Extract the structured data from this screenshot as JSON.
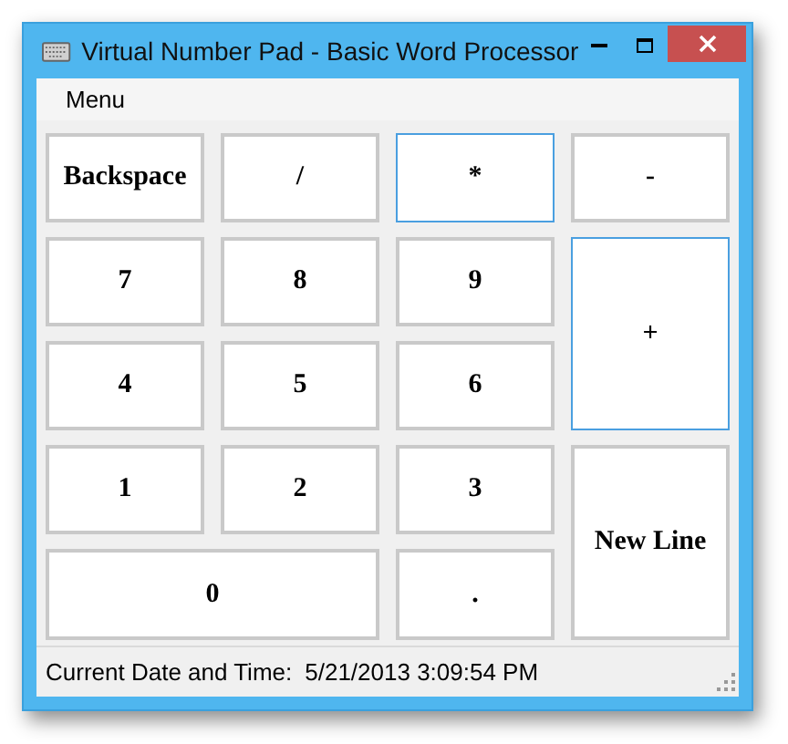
{
  "window": {
    "title": "Virtual Number Pad - Basic Word Processor"
  },
  "menu_bar": [
    "Menu"
  ],
  "keys": [
    {
      "label": "Backspace",
      "kind": "normal",
      "focused": false
    },
    {
      "label": "/",
      "kind": "normal",
      "focused": false
    },
    {
      "label": "*",
      "kind": "normal",
      "focused": true
    },
    {
      "label": "-",
      "kind": "normal",
      "focused": false
    },
    {
      "label": "7",
      "kind": "normal",
      "focused": false
    },
    {
      "label": "8",
      "kind": "normal",
      "focused": false
    },
    {
      "label": "9",
      "kind": "normal",
      "focused": false
    },
    {
      "label": "+",
      "kind": "tall",
      "focused": true
    },
    {
      "label": "4",
      "kind": "normal",
      "focused": false
    },
    {
      "label": "5",
      "kind": "normal",
      "focused": false
    },
    {
      "label": "6",
      "kind": "normal",
      "focused": false
    },
    {
      "label": "1",
      "kind": "normal",
      "focused": false
    },
    {
      "label": "2",
      "kind": "normal",
      "focused": false
    },
    {
      "label": "3",
      "kind": "normal",
      "focused": false
    },
    {
      "label": "New Line",
      "kind": "tall",
      "focused": false
    },
    {
      "label": "0",
      "kind": "wide",
      "focused": false
    },
    {
      "label": ".",
      "kind": "normal",
      "focused": false
    }
  ],
  "status_bar": {
    "label": "Current Date and Time:",
    "value": "5/21/2013 3:09:54 PM"
  }
}
